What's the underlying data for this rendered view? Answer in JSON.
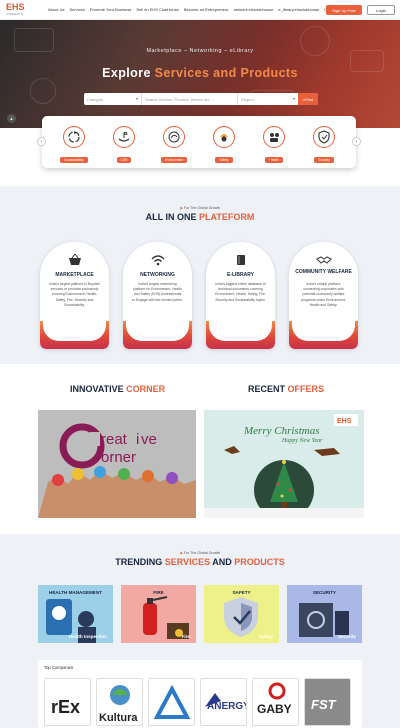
{
  "header": {
    "logo_text": "EHS",
    "logo_sub": "CONNECTS",
    "nav": [
      "About Us",
      "Services",
      "Promote Your Business",
      "Sell on EHS ClubHouse",
      "Become an Entrepreneur",
      "network.ehsclubhouse",
      "e_library.ehsclubhouse",
      "Contact"
    ],
    "signup_label": "Sign Up Free",
    "login_label": "Login"
  },
  "hero": {
    "subtitle": "Marketplace – Networking – eLibrary",
    "title_pre": "Explore ",
    "title_hl": "Services and Products",
    "search": {
      "category_placeholder": "Category",
      "input_placeholder": "Search Service, Product, Vendor etc.",
      "region_placeholder": "Region",
      "go_label": "Find"
    }
  },
  "categories": [
    {
      "label": "Sustainability",
      "icon": "recycle-icon"
    },
    {
      "label": "CSR",
      "icon": "hands-plant-icon"
    },
    {
      "label": "Environment",
      "icon": "environment-icon"
    },
    {
      "label": "Safety",
      "icon": "worker-helmet-icon"
    },
    {
      "label": "Health",
      "icon": "health-team-icon"
    },
    {
      "label": "Security",
      "icon": "shield-icon"
    }
  ],
  "platform": {
    "kicker": "For The Global Growth",
    "title_pre": "ALL IN ONE ",
    "title_hl": "PLATEFORM",
    "cards": [
      {
        "title": "MARKETPLACE",
        "icon": "basket-icon",
        "desc": "India's largest platform to Buy/sell services or products exclusively covering Environment, Health, Safety, Fire, Security and Sustainability."
      },
      {
        "title": "NETWORKING",
        "icon": "wifi-icon",
        "desc": "India's largest networking platform for Environment, Health and Safety (EHS) professionals to Engage with like minded peers."
      },
      {
        "title": "E-LIBRARY",
        "icon": "book-icon",
        "desc": "India's biggest online database of technical documents covering Environment, Health, Safety, Fire, Security and Sustainability topics."
      },
      {
        "title": "COMMUNITY WELFARE",
        "icon": "handshake-icon",
        "desc": "India's unique platform connecting corporates with potential community welfare programs under Environment, Health and Safety."
      }
    ]
  },
  "corner": {
    "innovative_pre": "INNOVATIVE ",
    "innovative_hl": "CORNER",
    "offers_pre": "RECENT ",
    "offers_hl": "OFFERS",
    "creative_word1": "reat",
    "creative_word2": "ve",
    "creative_word3": "orner",
    "offer_text1": "Merry Christmas",
    "offer_text2": "Happy New Year",
    "offer_logo": "EHS"
  },
  "trending": {
    "kicker": "For The Global Growth",
    "title_pre": "TRENDING ",
    "title_hl": "SERVICES",
    "title_mid": " AND ",
    "title_hl2": "PRODUCTS",
    "tiles": [
      {
        "label": "HEALTH MANAGEMENT",
        "caption": "Health Inspection",
        "bg": "#9bd0e8",
        "label_color": "#1a2540"
      },
      {
        "label": "FIRE",
        "caption": "Fire",
        "bg": "#f2a9a4",
        "label_color": "#1a2540"
      },
      {
        "label": "SAFETY",
        "caption": "Safety",
        "bg": "#eef08a",
        "label_color": "#1a2540"
      },
      {
        "label": "SECURITY",
        "caption": "Security",
        "bg": "#a9b8e6",
        "label_color": "#1a2540"
      }
    ],
    "companies_title": "Top Companies",
    "companies": [
      "rEx",
      "Kultura",
      "",
      "ANERGY",
      "GABY",
      "FST"
    ]
  },
  "colors": {
    "accent": "#e8603c",
    "navy": "#1a2540"
  }
}
